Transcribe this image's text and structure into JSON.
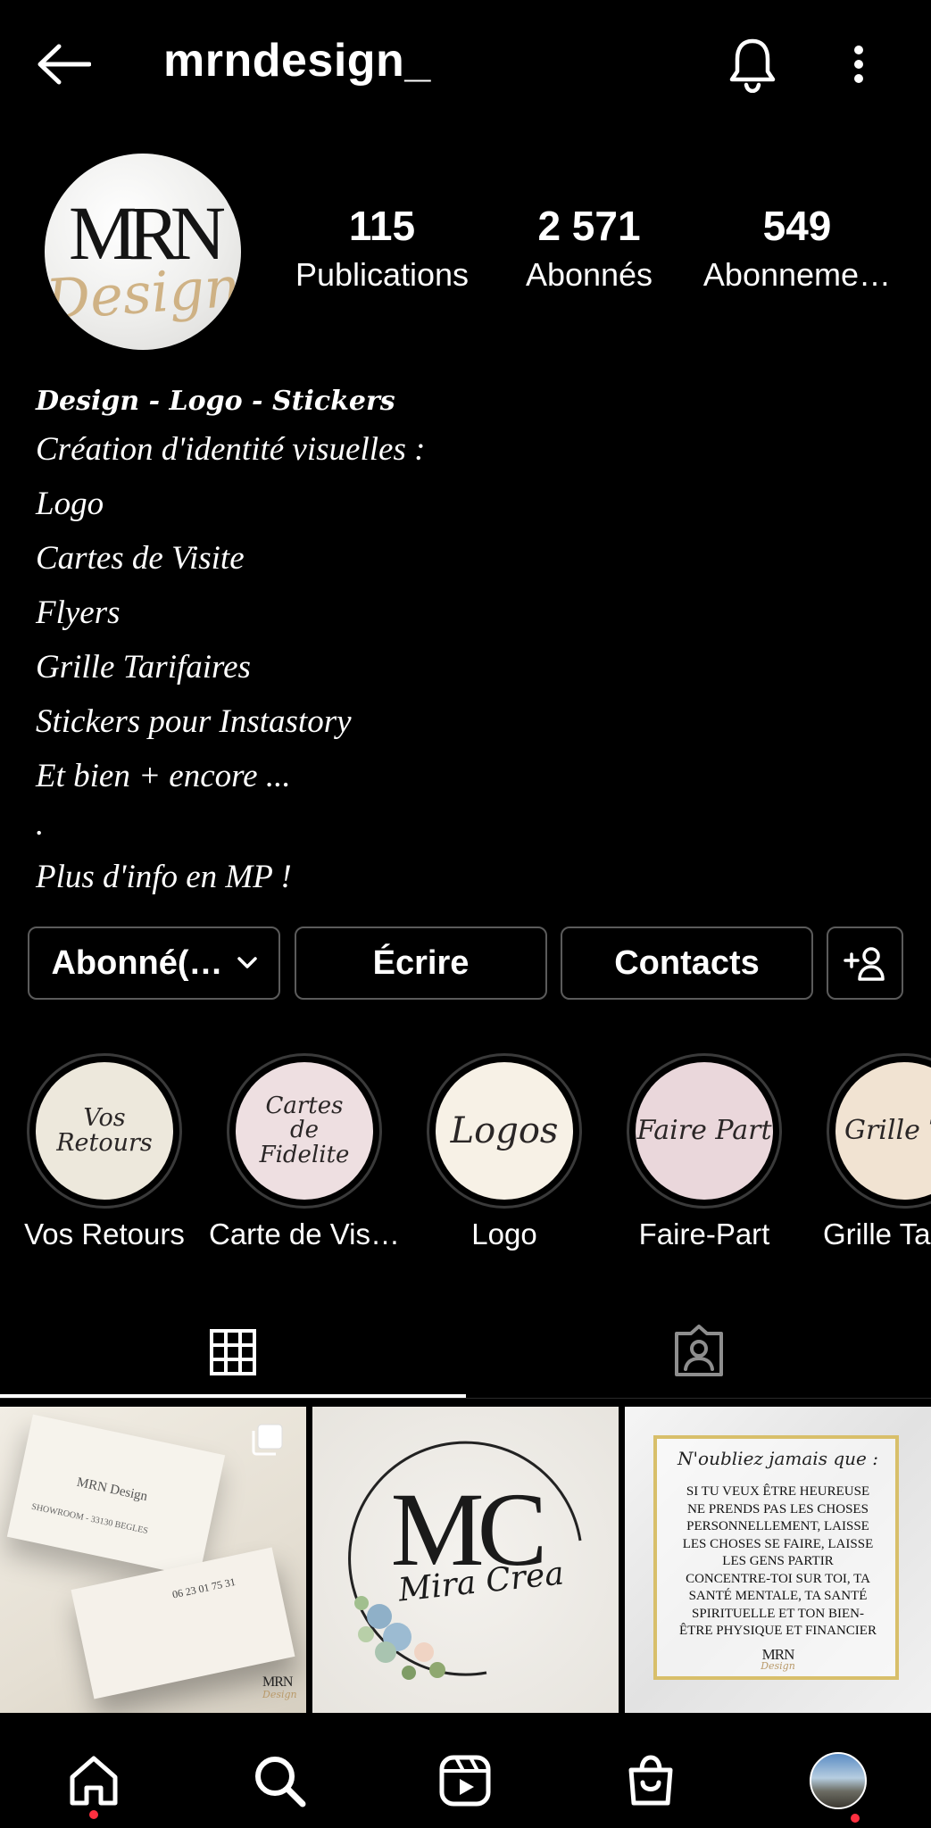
{
  "header": {
    "title": "mrndesign_"
  },
  "avatar": {
    "brand_letters": "MRN",
    "brand_script": "Design"
  },
  "stats": [
    {
      "value": "115",
      "label": "Publications"
    },
    {
      "value": "2 571",
      "label": "Abonnés"
    },
    {
      "value": "549",
      "label": "Abonneme…"
    }
  ],
  "bio": {
    "headline": "Design - Logo - Stickers",
    "lines": [
      "Création d'identité visuelles :",
      "Logo",
      "Cartes de Visite",
      "Flyers",
      "Grille Tarifaires",
      "Stickers pour Instastory",
      "Et bien + encore ...",
      ".",
      "Plus d'info en MP !"
    ]
  },
  "actions": {
    "following_label": "Abonné(…",
    "message_label": "Écrire",
    "contacts_label": "Contacts"
  },
  "highlights": [
    {
      "label": "Vos Retours",
      "cover_text": "Vos Retours",
      "cover_color": "#ede8dc"
    },
    {
      "label": "Carte de Vis…",
      "cover_text": "Cartes de Fidelite",
      "cover_color": "#eedfe1"
    },
    {
      "label": "Logo",
      "cover_text": "Logos",
      "cover_color": "#f7f1e6"
    },
    {
      "label": "Faire-Part",
      "cover_text": "Faire Part",
      "cover_color": "#ead7db"
    },
    {
      "label": "Grille Ta",
      "cover_text": "Grille Ta",
      "cover_color": "#f1e3d2"
    }
  ],
  "posts": [
    {
      "kind": "business-card-mockup",
      "card_name": "MRN Design",
      "showroom_line": "SHOWROOM - 33130 BEGLES",
      "phone": "06 23 01 75 31",
      "corner_logo": "MRN",
      "corner_script": "Design"
    },
    {
      "kind": "logo",
      "letters": "MC",
      "script": "Mira Crea"
    },
    {
      "kind": "quote",
      "heading": "N'oubliez jamais que :",
      "lines": [
        "SI TU VEUX ÊTRE HEUREUSE",
        "NE PRENDS PAS LES CHOSES",
        "PERSONNELLEMENT, LAISSE",
        "LES CHOSES SE FAIRE, LAISSE",
        "LES GENS PARTIR",
        "CONCENTRE-TOI SUR TOI, TA",
        "SANTÉ MENTALE, TA SANTÉ",
        "SPIRITUELLE ET TON BIEN-",
        "ÊTRE PHYSIQUE ET FINANCIER"
      ],
      "footer_logo": "MRN",
      "footer_script": "Design"
    }
  ],
  "icons": {
    "back": "back-arrow-icon",
    "bell": "bell-icon",
    "more": "more-vertical-icon",
    "add_user": "add-user-icon",
    "grid": "grid-icon",
    "tagged": "tagged-icon",
    "home": "home-icon",
    "search": "search-icon",
    "reels": "reels-icon",
    "shop": "shop-icon",
    "profile": "profile-avatar-icon"
  },
  "colors": {
    "background": "#000000",
    "button_border": "#5b5b5b",
    "notification_dot": "#ff3040"
  }
}
